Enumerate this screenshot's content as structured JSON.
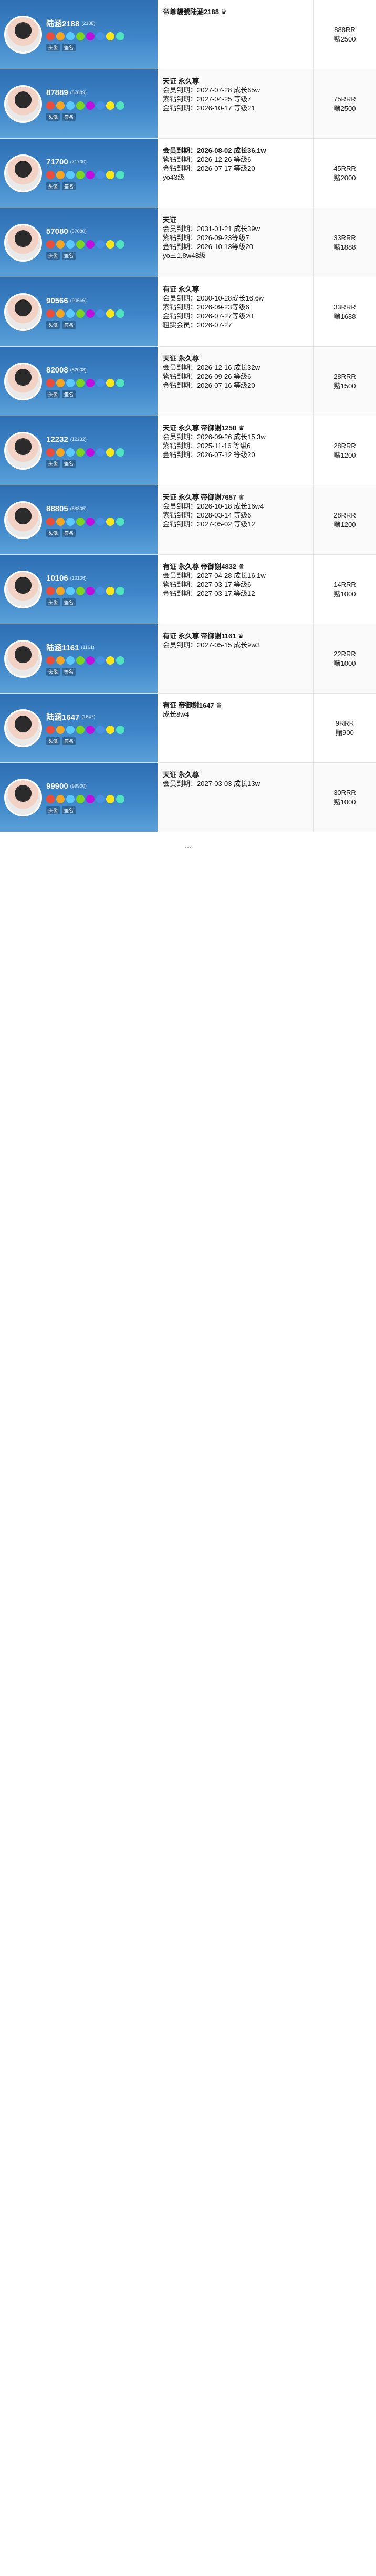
{
  "rows": [
    {
      "id": "陆涵2188",
      "id_sub": "(2188)",
      "tags": [
        "头像",
        "签名"
      ],
      "dark": false,
      "lines": [
        "帝尊靓號陆涵2188 ♛"
      ],
      "price": "888RR",
      "points": "赌2500"
    },
    {
      "id": "87889",
      "id_sub": "(87889)",
      "tags": [
        "头像",
        "签名"
      ],
      "dark": false,
      "lines": [
        "天证 永久尊",
        "会员到期：2027-07-28 成长65w",
        "紫钻到期：2027-04-25 等级7",
        "金钻到期：2026-10-17 等级21"
      ],
      "price": "75RRR",
      "points": "赌2500"
    },
    {
      "id": "71700",
      "id_sub": "(71700)",
      "tags": [
        "头像",
        "签名"
      ],
      "dark": false,
      "lines": [
        "会员到期：2026-08-02 成长36.1w",
        "紫钻到期：2026-12-26 等级6",
        "金钻到期：2026-07-17 等级20",
        "yo43级"
      ],
      "price": "45RRR",
      "points": "赌2000"
    },
    {
      "id": "57080",
      "id_sub": "(57080)",
      "tags": [
        "头像",
        "签名"
      ],
      "dark": false,
      "lines": [
        "天证",
        "会员到期：2031-01-21 成长39w",
        "紫钻到期：2026-09-23等级7",
        "金钻到期：2026-10-13等级20",
        "yo三1.8w43级"
      ],
      "price": "33RRR",
      "points": "赌1888"
    },
    {
      "id": "90566",
      "id_sub": "(90566)",
      "tags": [
        "头像",
        "签名"
      ],
      "dark": false,
      "lines": [
        "有证 永久尊",
        "会员到期：2030-10-28成长16.6w",
        "紫钻到期：2026-09-23等级6",
        "金钻到期：2026-07-27等级20",
        "粗实会员：2026-07-27"
      ],
      "price": "33RRR",
      "points": "赌1688"
    },
    {
      "id": "82008",
      "id_sub": "(82008)",
      "tags": [
        "头像",
        "签名"
      ],
      "dark": false,
      "lines": [
        "天证 永久尊",
        "会员到期：2026-12-16 成长32w",
        "紫钻到期：2026-09-26 等级6",
        "金钻到期：2026-07-16 等级20"
      ],
      "price": "28RRR",
      "points": "赌1500"
    },
    {
      "id": "12232",
      "id_sub": "(12232)",
      "tags": [
        "头像",
        "签名"
      ],
      "dark": false,
      "lines": [
        "天证 永久尊 帝御謝1250 ♛",
        "会员到期：2026-09-26 成长15.3w",
        "紫钻到期：2025-11-16 等级6",
        "金钻到期：2026-07-12 等级20"
      ],
      "price": "28RRR",
      "points": "赌1200"
    },
    {
      "id": "88805",
      "id_sub": "(88805)",
      "tags": [
        "头像",
        "签名"
      ],
      "dark": false,
      "lines": [
        "天证 永久尊 帝御謝7657 ♛",
        "会员到期：2026-10-18 成长16w4",
        "紫钻到期：2028-03-14 等级6",
        "金钻到期：2027-05-02 等级12"
      ],
      "price": "28RRR",
      "points": "赌1200"
    },
    {
      "id": "10106",
      "id_sub": "(10106)",
      "tags": [
        "头像",
        "签名"
      ],
      "dark": false,
      "lines": [
        "有证 永久尊 帝御謝4832 ♛",
        "会员到期：2027-04-28 成长16.1w",
        "紫钻到期：2027-03-17 等级6",
        "金钻到期：2027-03-17 等级12"
      ],
      "price": "14RRR",
      "points": "赌1000"
    },
    {
      "id": "陆涵1161",
      "id_sub": "(1161)",
      "tags": [
        "头像",
        "签名"
      ],
      "dark": false,
      "lines": [
        "有证 永久尊 帝御謝1161 ♛",
        "会员到期：2027-05-15 成长9w3"
      ],
      "price": "22RRR",
      "points": "赌1000"
    },
    {
      "id": "陆涵1647",
      "id_sub": "(1647)",
      "tags": [
        "头像",
        "签名"
      ],
      "dark": false,
      "lines": [
        "有证 帝御謝1647 ♛",
        "成长8w4"
      ],
      "price": "9RRR",
      "points": "赌900"
    },
    {
      "id": "99900",
      "id_sub": "(99900)",
      "tags": [
        "头像",
        "签名"
      ],
      "dark": false,
      "lines": [
        "天证 永久尊",
        "会员到期：2027-03-03 成长13w"
      ],
      "price": "30RRR",
      "points": "赌1000"
    }
  ],
  "more_label": "…"
}
